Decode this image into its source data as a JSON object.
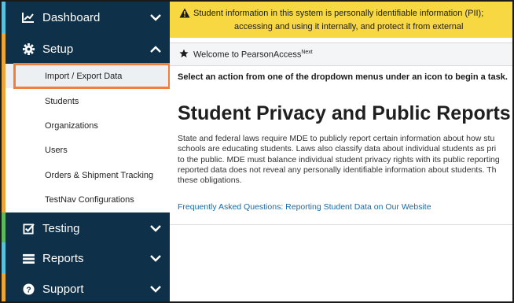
{
  "sidebar": {
    "dashboard": {
      "label": "Dashboard",
      "icon": "line-chart-icon",
      "strip_color": "#5bc0de"
    },
    "setup": {
      "label": "Setup",
      "icon": "gear-icon",
      "strip_color": "#e8a63b",
      "expanded": true,
      "items": [
        {
          "label": "Import / Export Data",
          "selected": true
        },
        {
          "label": "Students"
        },
        {
          "label": "Organizations"
        },
        {
          "label": "Users"
        },
        {
          "label": "Orders & Shipment Tracking"
        },
        {
          "label": "TestNav Configurations"
        }
      ]
    },
    "testing": {
      "label": "Testing",
      "icon": "checkbox-icon",
      "strip_color": "#5cb85c"
    },
    "reports": {
      "label": "Reports",
      "icon": "list-icon",
      "strip_color": "#5bc0de"
    },
    "support": {
      "label": "Support",
      "icon": "question-circle-icon",
      "strip_color": "#e8a63b"
    }
  },
  "banner": {
    "line1": "Student information in this system is personally identifiable information (PII);",
    "line2": "accessing and using it internally, and protect it from external",
    "icon": "warning-icon"
  },
  "welcome": {
    "text": "Welcome to PearsonAccess",
    "superscript": "Next",
    "icon": "star-icon"
  },
  "instruction": "Select an action from one of the dropdown menus under an icon to begin a task.",
  "main": {
    "title": "Student Privacy and Public Reports",
    "body_lines": [
      "State and federal laws require MDE to publicly report certain information about how stu",
      "schools are educating students. Laws also classify data about individual students as pri",
      "to the public. MDE must balance individual student privacy rights with its public reporting",
      "reported data does not reveal any personally identifiable information about students. Th",
      "these obligations."
    ],
    "faq_link": "Frequently Asked Questions: Reporting Student Data on Our Website"
  },
  "colors": {
    "sidebar_bg": "#0f3049",
    "banner_bg": "#f7d842",
    "highlight": "#f07f3c",
    "link": "#1a6aa6"
  }
}
